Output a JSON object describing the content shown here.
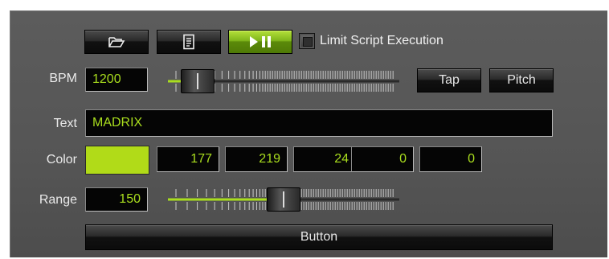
{
  "toolbar": {
    "open_icon": "folder-open-icon",
    "script_icon": "document-icon",
    "play_pause_icon": "play-pause-icon",
    "limit_label": "Limit Script Execution",
    "limit_checked": false
  },
  "bpm": {
    "label": "BPM",
    "value": "1200",
    "slider_fraction": 0.13,
    "tap_label": "Tap",
    "pitch_label": "Pitch"
  },
  "text": {
    "label": "Text",
    "value": "MADRIX"
  },
  "color": {
    "label": "Color",
    "swatch": "#b1db18",
    "values": [
      "177",
      "219",
      "24",
      "0",
      "0"
    ]
  },
  "range": {
    "label": "Range",
    "value": "150",
    "slider_fraction": 0.5
  },
  "button": {
    "label": "Button"
  },
  "colors": {
    "accent": "#a9dd1e",
    "panel": "#555555"
  }
}
